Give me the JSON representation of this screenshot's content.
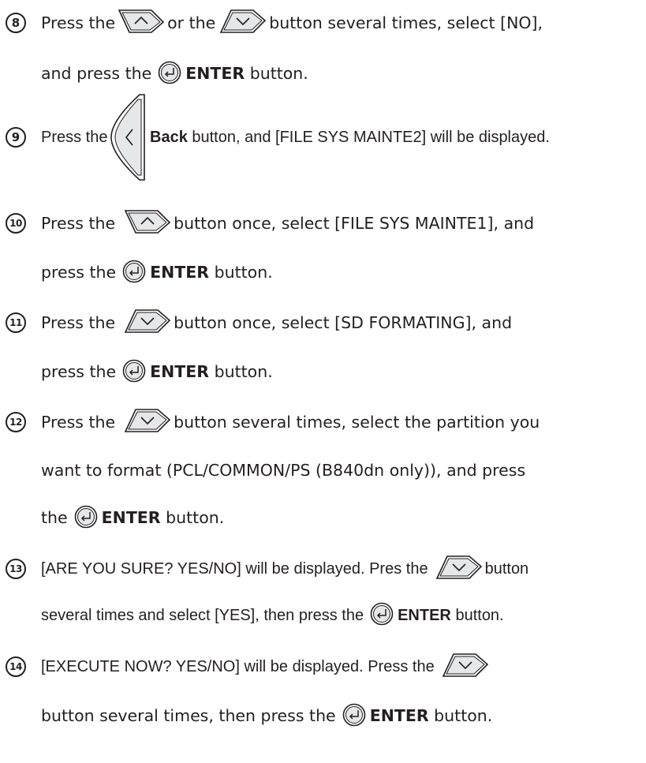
{
  "steps": [
    {
      "number": "8",
      "lines": [
        [
          "Press the",
          "or the",
          "button several times, select [NO],"
        ],
        [
          "and press the",
          "ENTER",
          "button."
        ]
      ]
    },
    {
      "number": "9",
      "parts": [
        "Press the",
        "Back",
        "button, and [FILE SYS MAINTE2] will be displayed."
      ]
    },
    {
      "number": "10",
      "lines": [
        [
          "Press the",
          "button once, select [FILE SYS MAINTE1], and"
        ],
        [
          "press the",
          "ENTER",
          "button."
        ]
      ]
    },
    {
      "number": "11",
      "lines": [
        [
          "Press the",
          "button once, select [SD FORMATING], and"
        ],
        [
          "press the",
          "ENTER",
          "button."
        ]
      ]
    },
    {
      "number": "12",
      "lines": [
        [
          "Press the",
          "button several times, select the partition you"
        ],
        [
          "want to format (PCL/COMMON/PS (B840dn only)), and press"
        ],
        [
          "the",
          "ENTER",
          "button."
        ]
      ]
    },
    {
      "number": "13",
      "lines": [
        [
          "[ARE YOU SURE? YES/NO] will be displayed. Pres the",
          "button"
        ],
        [
          "several times and select [YES], then press the",
          "ENTER",
          "button."
        ]
      ]
    },
    {
      "number": "14",
      "lines": [
        [
          "[EXECUTE NOW? YES/NO] will be displayed. Press the"
        ],
        [
          "button several times, then press the",
          "ENTER",
          "button."
        ]
      ]
    }
  ],
  "icons": {
    "up": "up-arrow-button-icon",
    "down": "down-arrow-button-icon",
    "enter": "enter-button-icon",
    "back": "back-button-icon"
  }
}
